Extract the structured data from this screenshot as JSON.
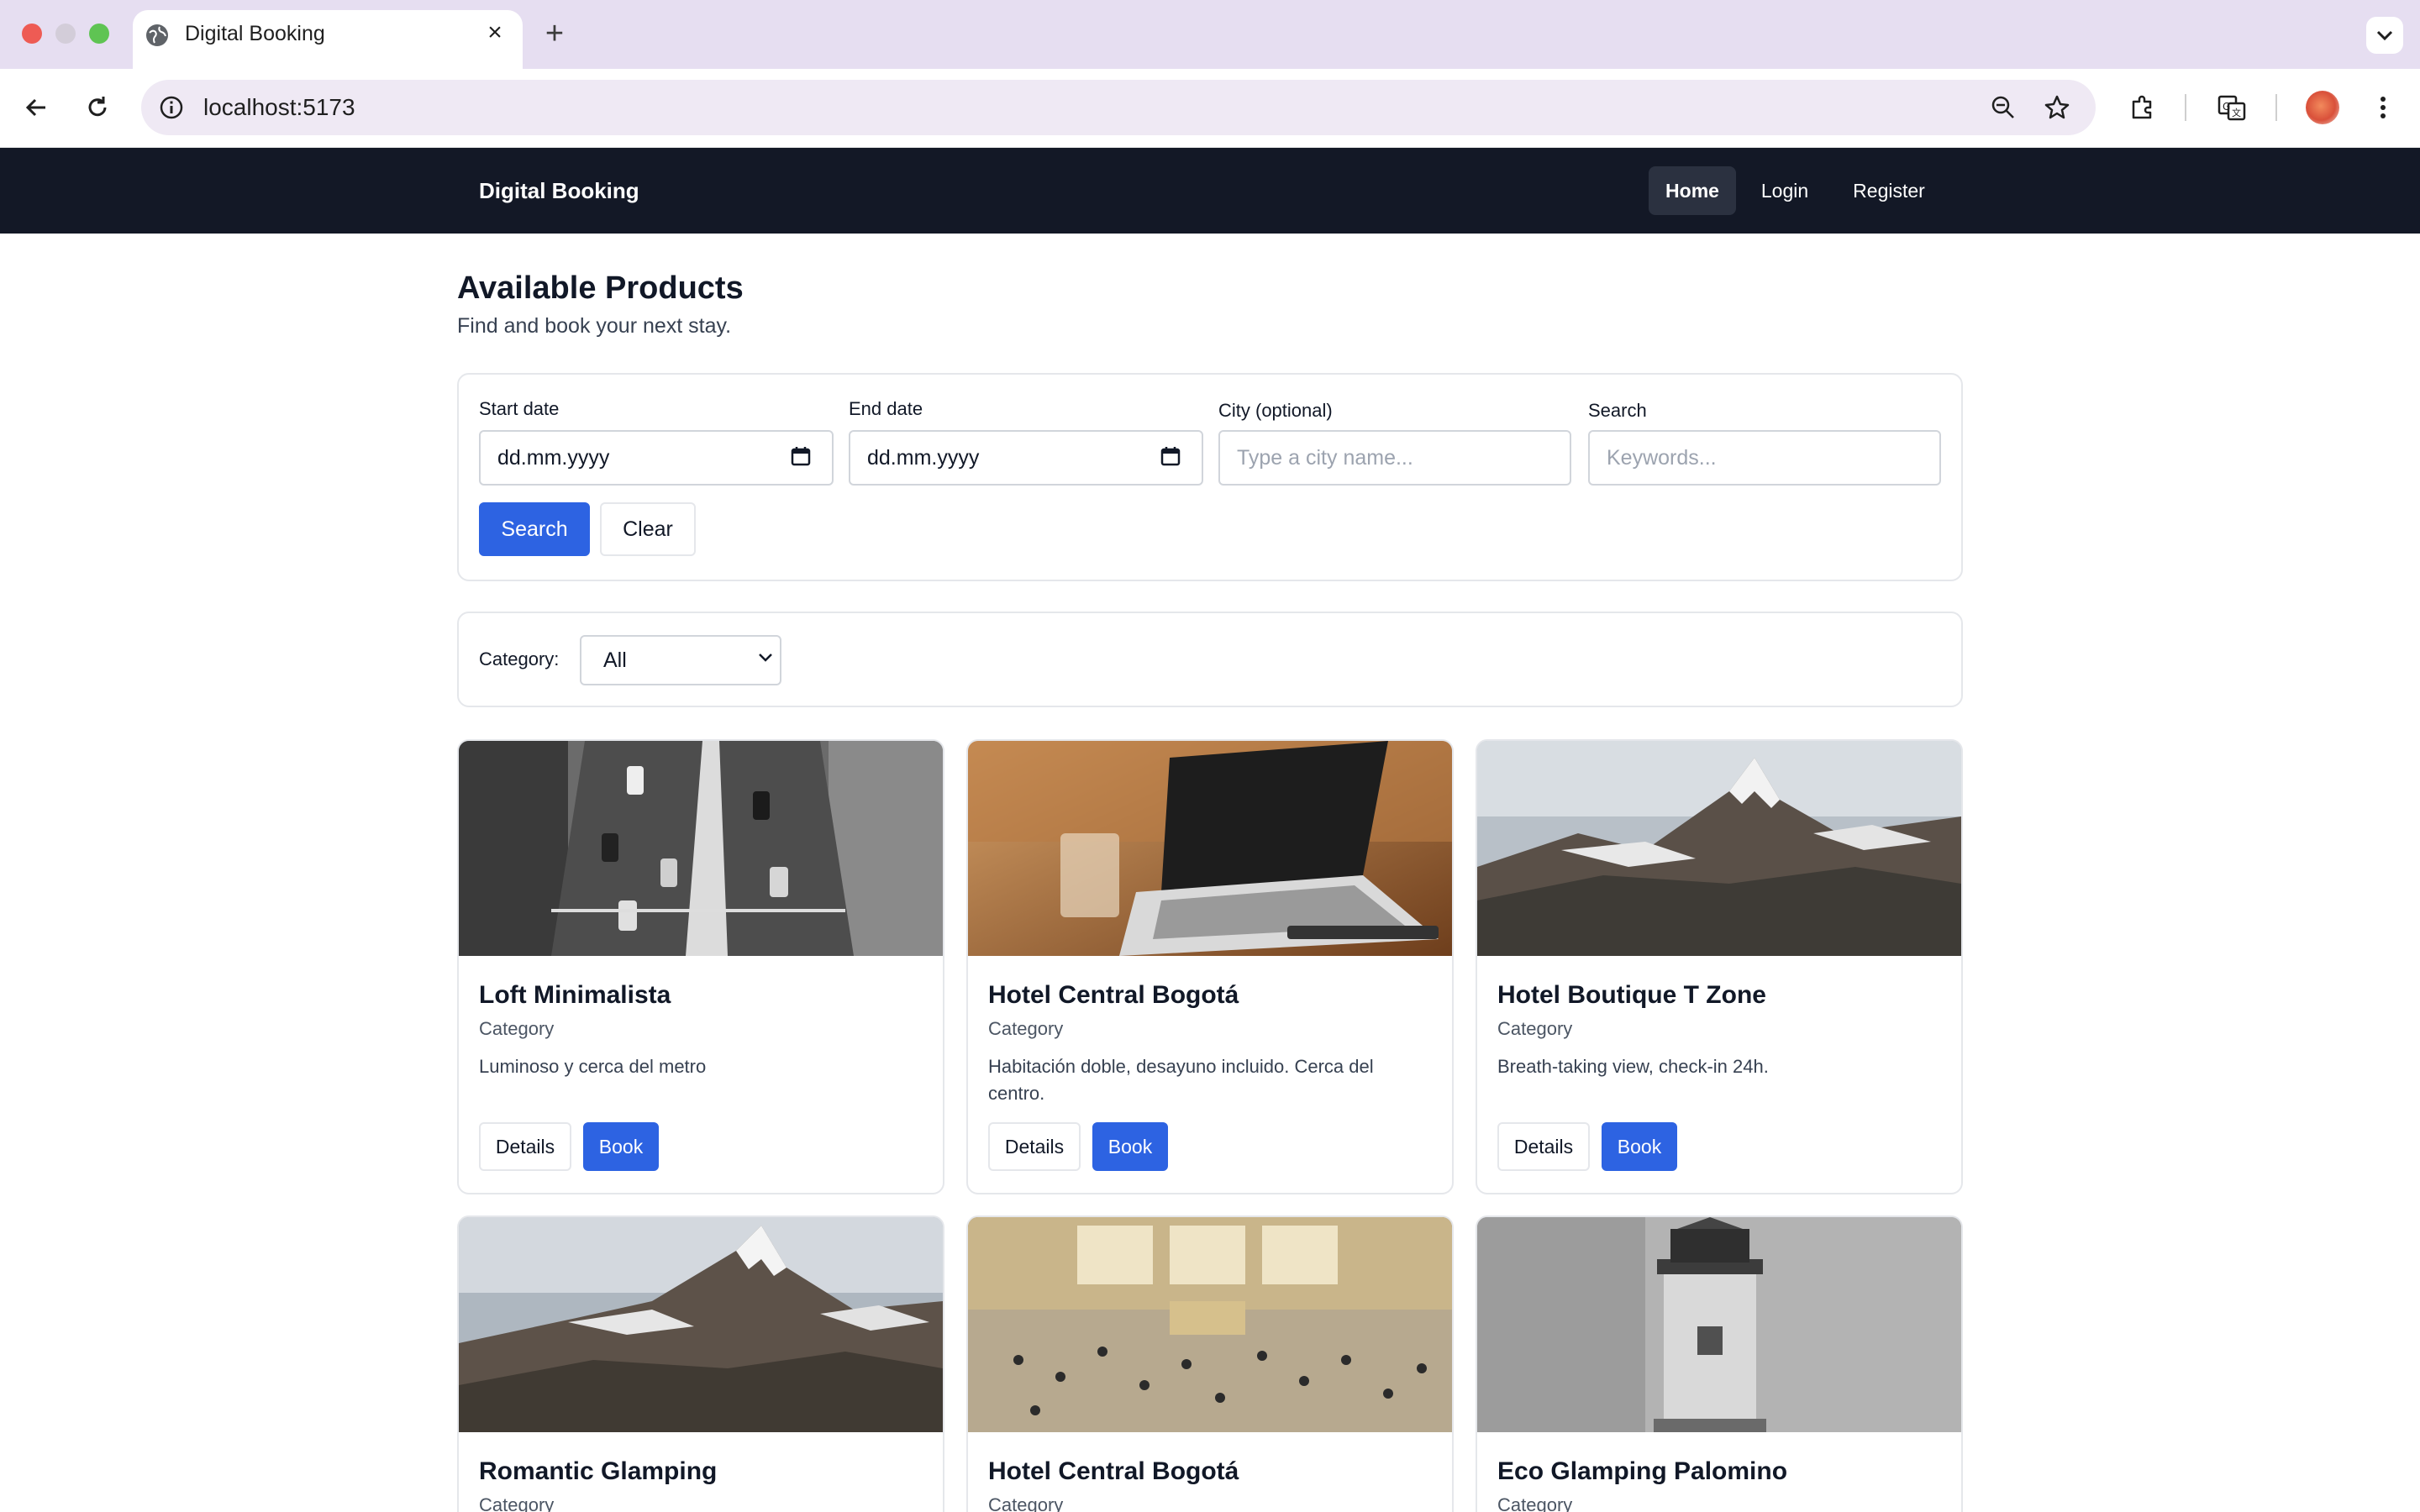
{
  "browser": {
    "tab_title": "Digital Booking",
    "url": "localhost:5173"
  },
  "navbar": {
    "brand": "Digital Booking",
    "links": [
      {
        "label": "Home",
        "active": true
      },
      {
        "label": "Login",
        "active": false
      },
      {
        "label": "Register",
        "active": false
      }
    ]
  },
  "header": {
    "title": "Available Products",
    "subtitle": "Find and book your next stay."
  },
  "search_form": {
    "start_date": {
      "label": "Start date",
      "value": "dd.mm.yyyy"
    },
    "end_date": {
      "label": "End date",
      "value": "dd.mm.yyyy"
    },
    "city": {
      "label": "City (optional)",
      "placeholder": "Type a city name..."
    },
    "keywords": {
      "label": "Search",
      "placeholder": "Keywords..."
    },
    "search_button": "Search",
    "clear_button": "Clear"
  },
  "filter": {
    "label": "Category:",
    "selected": "All"
  },
  "products": [
    {
      "name": "Loft Minimalista",
      "category": "Category",
      "description": "Luminoso y cerca del metro",
      "details_label": "Details",
      "book_label": "Book",
      "image": "city-street-photo"
    },
    {
      "name": "Hotel Central Bogotá",
      "category": "Category",
      "description": "Habitación doble, desayuno incluido. Cerca del centro.",
      "details_label": "Details",
      "book_label": "Book",
      "image": "laptop-desk-photo"
    },
    {
      "name": "Hotel Boutique T Zone",
      "category": "Category",
      "description": "Breath-taking view, check-in 24h.",
      "details_label": "Details",
      "book_label": "Book",
      "image": "mountain-photo"
    },
    {
      "name": "Romantic Glamping",
      "category": "Category",
      "description": "",
      "image": "mountain-photo"
    },
    {
      "name": "Hotel Central Bogotá",
      "category": "Category",
      "description": "",
      "image": "station-hall-photo"
    },
    {
      "name": "Eco Glamping Palomino",
      "category": "Category",
      "description": "",
      "image": "lighthouse-photo"
    }
  ],
  "colors": {
    "navbar_bg": "#131826",
    "primary": "#2d63e2",
    "tabstrip_bg": "#e6def1"
  }
}
